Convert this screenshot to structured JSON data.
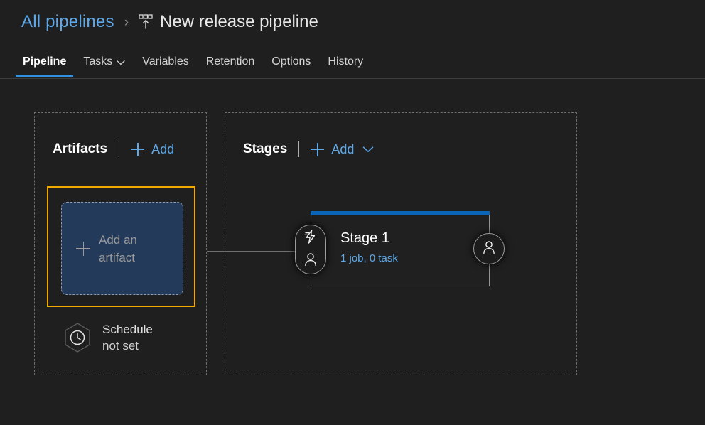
{
  "breadcrumb": {
    "parent_label": "All pipelines",
    "separator": "›",
    "current_icon": "release-pipeline-icon",
    "current_label": "New release pipeline"
  },
  "tabs": [
    {
      "label": "Pipeline",
      "active": true,
      "has_chevron": false
    },
    {
      "label": "Tasks",
      "active": false,
      "has_chevron": true
    },
    {
      "label": "Variables",
      "active": false,
      "has_chevron": false
    },
    {
      "label": "Retention",
      "active": false,
      "has_chevron": false
    },
    {
      "label": "Options",
      "active": false,
      "has_chevron": false
    },
    {
      "label": "History",
      "active": false,
      "has_chevron": false
    }
  ],
  "artifacts": {
    "title": "Artifacts",
    "add_label": "Add",
    "add_icon": "plus-icon",
    "tile": {
      "icon": "plus-icon",
      "line1": "Add an",
      "line2": "artifact"
    },
    "schedule": {
      "icon": "clock-icon",
      "line1": "Schedule",
      "line2": "not set"
    }
  },
  "stages": {
    "title": "Stages",
    "add_label": "Add",
    "add_icon": "plus-icon",
    "add_chevron_icon": "chevron-down-icon",
    "stage": {
      "name": "Stage 1",
      "summary": "1 job, 0 task",
      "pre_deployment_icons": [
        "lightning-bolt-icon",
        "person-icon"
      ],
      "post_deployment_icon": "person-icon"
    }
  },
  "colors": {
    "background": "#1f1f1f",
    "link": "#5fa8e8",
    "accent_blue": "#0a65b8",
    "focus_outline": "#f2a900",
    "artifact_tile_fill": "#243a5a",
    "dashed_border": "#6e6e6e"
  }
}
